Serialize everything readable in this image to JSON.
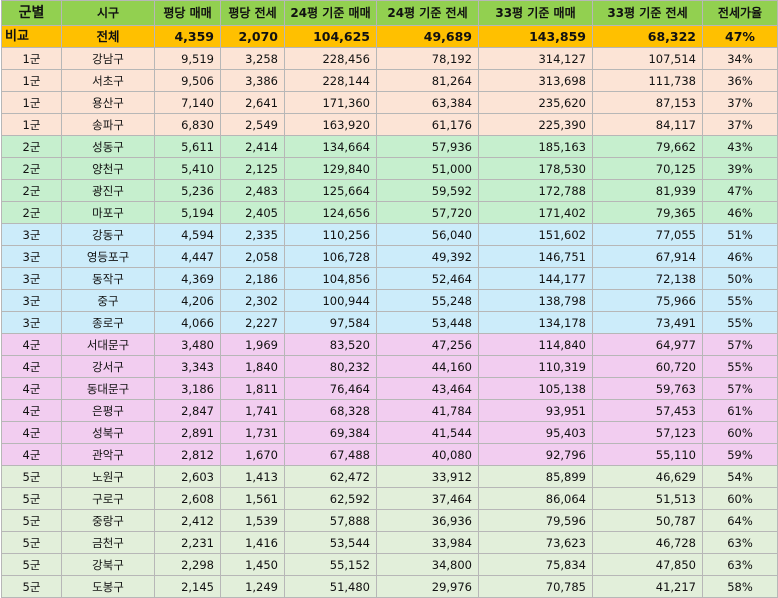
{
  "table": {
    "headers": [
      "군별",
      "시구",
      "평당 매매",
      "평당 전세",
      "24평 기준 매매",
      "24평 기준 전세",
      "33평 기준 매매",
      "33평 기준 전세",
      "전세가율"
    ],
    "total": [
      "비교",
      "전체",
      "4,359",
      "2,070",
      "104,625",
      "49,689",
      "143,859",
      "68,322",
      "47%"
    ],
    "rows": [
      [
        "1군",
        "강남구",
        "9,519",
        "3,258",
        "228,456",
        "78,192",
        "314,127",
        "107,514",
        "34%"
      ],
      [
        "1군",
        "서초구",
        "9,506",
        "3,386",
        "228,144",
        "81,264",
        "313,698",
        "111,738",
        "36%"
      ],
      [
        "1군",
        "용산구",
        "7,140",
        "2,641",
        "171,360",
        "63,384",
        "235,620",
        "87,153",
        "37%"
      ],
      [
        "1군",
        "송파구",
        "6,830",
        "2,549",
        "163,920",
        "61,176",
        "225,390",
        "84,117",
        "37%"
      ],
      [
        "2군",
        "성동구",
        "5,611",
        "2,414",
        "134,664",
        "57,936",
        "185,163",
        "79,662",
        "43%"
      ],
      [
        "2군",
        "양천구",
        "5,410",
        "2,125",
        "129,840",
        "51,000",
        "178,530",
        "70,125",
        "39%"
      ],
      [
        "2군",
        "광진구",
        "5,236",
        "2,483",
        "125,664",
        "59,592",
        "172,788",
        "81,939",
        "47%"
      ],
      [
        "2군",
        "마포구",
        "5,194",
        "2,405",
        "124,656",
        "57,720",
        "171,402",
        "79,365",
        "46%"
      ],
      [
        "3군",
        "강동구",
        "4,594",
        "2,335",
        "110,256",
        "56,040",
        "151,602",
        "77,055",
        "51%"
      ],
      [
        "3군",
        "영등포구",
        "4,447",
        "2,058",
        "106,728",
        "49,392",
        "146,751",
        "67,914",
        "46%"
      ],
      [
        "3군",
        "동작구",
        "4,369",
        "2,186",
        "104,856",
        "52,464",
        "144,177",
        "72,138",
        "50%"
      ],
      [
        "3군",
        "중구",
        "4,206",
        "2,302",
        "100,944",
        "55,248",
        "138,798",
        "75,966",
        "55%"
      ],
      [
        "3군",
        "종로구",
        "4,066",
        "2,227",
        "97,584",
        "53,448",
        "134,178",
        "73,491",
        "55%"
      ],
      [
        "4군",
        "서대문구",
        "3,480",
        "1,969",
        "83,520",
        "47,256",
        "114,840",
        "64,977",
        "57%"
      ],
      [
        "4군",
        "강서구",
        "3,343",
        "1,840",
        "80,232",
        "44,160",
        "110,319",
        "60,720",
        "55%"
      ],
      [
        "4군",
        "동대문구",
        "3,186",
        "1,811",
        "76,464",
        "43,464",
        "105,138",
        "59,763",
        "57%"
      ],
      [
        "4군",
        "은평구",
        "2,847",
        "1,741",
        "68,328",
        "41,784",
        "93,951",
        "57,453",
        "61%"
      ],
      [
        "4군",
        "성북구",
        "2,891",
        "1,731",
        "69,384",
        "41,544",
        "95,403",
        "57,123",
        "60%"
      ],
      [
        "4군",
        "관악구",
        "2,812",
        "1,670",
        "67,488",
        "40,080",
        "92,796",
        "55,110",
        "59%"
      ],
      [
        "5군",
        "노원구",
        "2,603",
        "1,413",
        "62,472",
        "33,912",
        "85,899",
        "46,629",
        "54%"
      ],
      [
        "5군",
        "구로구",
        "2,608",
        "1,561",
        "62,592",
        "37,464",
        "86,064",
        "51,513",
        "60%"
      ],
      [
        "5군",
        "중랑구",
        "2,412",
        "1,539",
        "57,888",
        "36,936",
        "79,596",
        "50,787",
        "64%"
      ],
      [
        "5군",
        "금천구",
        "2,231",
        "1,416",
        "53,544",
        "33,984",
        "73,623",
        "46,728",
        "63%"
      ],
      [
        "5군",
        "강북구",
        "2,298",
        "1,450",
        "55,152",
        "34,800",
        "75,834",
        "47,850",
        "63%"
      ],
      [
        "5군",
        "도봉구",
        "2,145",
        "1,249",
        "51,480",
        "29,976",
        "70,785",
        "41,217",
        "58%"
      ]
    ]
  },
  "colors": {
    "header": "#92d050",
    "total": "#ffc000",
    "group1": "#fce4d6",
    "group2": "#c6efce",
    "group3": "#ccecfa",
    "group4": "#f2cdf0",
    "group5": "#e2efda"
  }
}
